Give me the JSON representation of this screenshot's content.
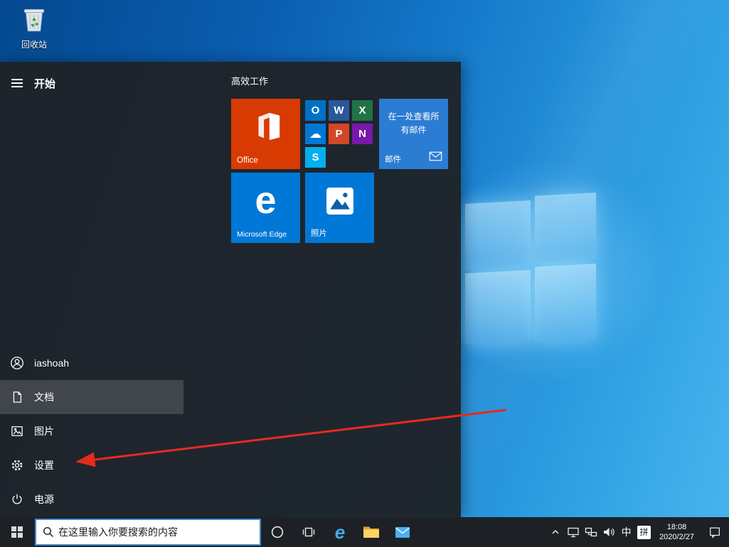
{
  "desktop": {
    "recycle_bin": {
      "label": "回收站"
    }
  },
  "start_menu": {
    "title": "开始",
    "section_title": "高效工作",
    "sidebar_items": [
      {
        "label": "iashoah"
      },
      {
        "label": "文档"
      },
      {
        "label": "图片"
      },
      {
        "label": "设置"
      },
      {
        "label": "电源"
      }
    ],
    "tiles": {
      "office": {
        "label": "Office"
      },
      "office_group": {
        "icons": [
          {
            "glyph": "O"
          },
          {
            "glyph": "W"
          },
          {
            "glyph": "X"
          },
          {
            "glyph": "☁"
          },
          {
            "glyph": "P"
          },
          {
            "glyph": "N"
          },
          {
            "glyph": "S"
          }
        ]
      },
      "mail": {
        "title": "在一处查看所有邮件",
        "label": "邮件"
      },
      "edge": {
        "glyph": "e",
        "label": "Microsoft Edge"
      },
      "photos": {
        "label": "照片"
      }
    }
  },
  "taskbar": {
    "search": {
      "placeholder": "在这里输入你要搜索的内容"
    },
    "edge_glyph": "e",
    "tray": {
      "ime_language": "中",
      "ime_mode": "拼",
      "time": "18:08",
      "date": "2020/2/27"
    }
  },
  "colors": {
    "accent_blue": "#0078d7",
    "office_orange": "#d83b01",
    "mail_tile_blue": "#2b7cd3",
    "start_menu_bg": "#1f2328",
    "taskbar_bg": "#1d2126",
    "arrow_red": "#e62b1e"
  }
}
